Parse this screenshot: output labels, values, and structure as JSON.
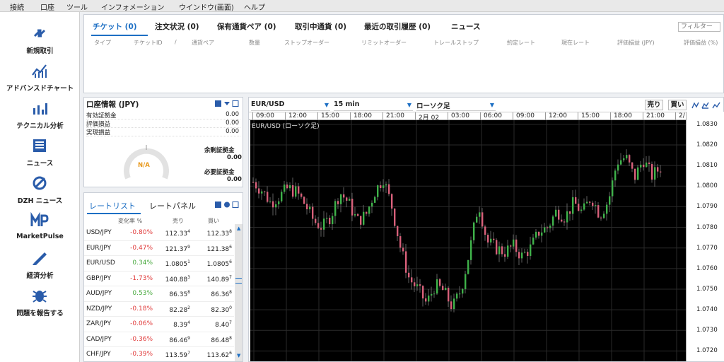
{
  "menu": [
    "接続",
    "口座",
    "ツール",
    "インフォメーション",
    "ウインドウ(画面)",
    "ヘルプ"
  ],
  "sidebar": [
    {
      "label": "新規取引",
      "icon": "new-trade-icon"
    },
    {
      "label": "アドバンスドチャート",
      "icon": "advanced-chart-icon"
    },
    {
      "label": "テクニカル分析",
      "icon": "technical-analysis-icon"
    },
    {
      "label": "ニュース",
      "icon": "news-icon"
    },
    {
      "label": "DZH ニュース",
      "icon": "dzh-news-icon"
    },
    {
      "label": "MarketPulse",
      "icon": "marketpulse-icon"
    },
    {
      "label": "経済分析",
      "icon": "economic-analysis-icon"
    },
    {
      "label": "問題を報告する",
      "icon": "report-problem-icon"
    }
  ],
  "top_tabs": [
    "チケット (0)",
    "注文状況 (0)",
    "保有通貨ペア (0)",
    "取引中通貨 (0)",
    "最近の取引履歴 (0)",
    "ニュース"
  ],
  "filter_placeholder": "フィルター",
  "ticket_columns": [
    "タイプ",
    "チケットID",
    "/",
    "通貨ペア",
    "数量",
    "ストップオーダー",
    "リミットオーダー",
    "トレールストップ",
    "約定レート",
    "現在レート",
    "評価損益 (JPY)",
    "評価損益 (%)"
  ],
  "account": {
    "title": "口座情報 (JPY)",
    "rows": [
      {
        "label": "有効証拠金",
        "value": "0.00"
      },
      {
        "label": "評価損益",
        "value": "0.00"
      },
      {
        "label": "実現損益",
        "value": "0.00"
      }
    ],
    "gauge_value": "N/A",
    "free_margin_label": "余剰証拠金",
    "free_margin_value": "0.00",
    "required_margin_label": "必要証拠金",
    "required_margin_value": "0.00"
  },
  "rates": {
    "tabs": [
      "レートリスト",
      "レートパネル"
    ],
    "headers": [
      "変化率 %",
      "売り",
      "買い"
    ],
    "rows": [
      {
        "pair": "USD/JPY",
        "change": "-0.80%",
        "bid": "112.33",
        "bid_sup": "4",
        "ask": "112.33",
        "ask_sup": "8",
        "dir": "neg"
      },
      {
        "pair": "EUR/JPY",
        "change": "-0.47%",
        "bid": "121.37",
        "bid_sup": "9",
        "ask": "121.38",
        "ask_sup": "6",
        "dir": "neg"
      },
      {
        "pair": "EUR/USD",
        "change": "0.34%",
        "bid": "1.0805",
        "bid_sup": "1",
        "ask": "1.0805",
        "ask_sup": "6",
        "dir": "pos"
      },
      {
        "pair": "GBP/JPY",
        "change": "-1.73%",
        "bid": "140.88",
        "bid_sup": "3",
        "ask": "140.89",
        "ask_sup": "7",
        "dir": "neg"
      },
      {
        "pair": "AUD/JPY",
        "change": "0.53%",
        "bid": "86.35",
        "bid_sup": "8",
        "ask": "86.36",
        "ask_sup": "8",
        "dir": "pos"
      },
      {
        "pair": "NZD/JPY",
        "change": "-0.18%",
        "bid": "82.28",
        "bid_sup": "2",
        "ask": "82.30",
        "ask_sup": "0",
        "dir": "neg"
      },
      {
        "pair": "ZAR/JPY",
        "change": "-0.06%",
        "bid": "8.39",
        "bid_sup": "4",
        "ask": "8.40",
        "ask_sup": "7",
        "dir": "neg"
      },
      {
        "pair": "CAD/JPY",
        "change": "-0.36%",
        "bid": "86.46",
        "bid_sup": "9",
        "ask": "86.48",
        "ask_sup": "8",
        "dir": "neg"
      },
      {
        "pair": "CHF/JPY",
        "change": "-0.39%",
        "bid": "113.59",
        "bid_sup": "7",
        "ask": "113.62",
        "ask_sup": "6",
        "dir": "neg"
      }
    ]
  },
  "chart": {
    "symbol": "EUR/USD",
    "timeframe": "15 min",
    "chart_type": "ローソク足",
    "sell_label": "売り",
    "buy_label": "買い",
    "plot_label": "EUR/USD (ローソク足)",
    "time_labels": [
      "09:00",
      "12:00",
      "15:00",
      "18:00",
      "21:00",
      "2月 02",
      "03:00",
      "06:00",
      "09:00",
      "12:00",
      "15:00",
      "18:00",
      "21:00",
      "2/"
    ],
    "y_labels": [
      "1.0830",
      "1.0820",
      "1.0810",
      "1.0800",
      "1.0790",
      "1.0780",
      "1.0770",
      "1.0760",
      "1.0750",
      "1.0740",
      "1.0730",
      "1.0720"
    ],
    "colors": {
      "up": "#3fb24a",
      "down": "#d8607a",
      "bg": "#000000",
      "grid": "#2a2a2a"
    }
  },
  "chart_data": {
    "type": "candlestick",
    "symbol": "EUR/USD",
    "ylim": [
      1.0715,
      1.0832
    ],
    "close_path": [
      1.0802,
      1.0798,
      1.0792,
      1.0795,
      1.0799,
      1.0797,
      1.0791,
      1.0783,
      1.078,
      1.0786,
      1.0797,
      1.0792,
      1.0783,
      1.0786,
      1.0797,
      1.0804,
      1.079,
      1.077,
      1.0755,
      1.075,
      1.0743,
      1.0752,
      1.0749,
      1.0741,
      1.075,
      1.0769,
      1.0792,
      1.0773,
      1.077,
      1.0768,
      1.0771,
      1.0766,
      1.077,
      1.0778,
      1.078,
      1.0788,
      1.0785,
      1.0792,
      1.0787,
      1.0795,
      1.0786,
      1.0793,
      1.0812,
      1.0814,
      1.0804,
      1.0813,
      1.0805,
      1.0809
    ]
  }
}
